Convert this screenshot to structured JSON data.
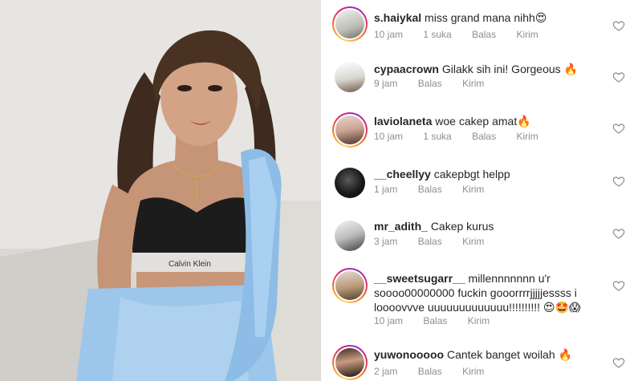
{
  "comments": [
    {
      "username": "s.haiykal",
      "text": "miss grand mana nihh😍",
      "time": "10 jam",
      "likes": "1 suka",
      "reply": "Balas",
      "send": "Kirim",
      "story_ring": true
    },
    {
      "username": "cypaacrown",
      "text": "Gilakk sih ini! Gorgeous 🔥",
      "time": "9 jam",
      "reply": "Balas",
      "send": "Kirim",
      "story_ring": false
    },
    {
      "username": "laviolaneta",
      "text": "woe cakep amat🔥",
      "time": "10 jam",
      "likes": "1 suka",
      "reply": "Balas",
      "send": "Kirim",
      "story_ring": true
    },
    {
      "username": "__cheellyy",
      "text": "cakepbgt helpp",
      "time": "1 jam",
      "reply": "Balas",
      "send": "Kirim",
      "story_ring": false
    },
    {
      "username": "mr_adith_",
      "text": "Cakep kurus",
      "time": "3 jam",
      "reply": "Balas",
      "send": "Kirim",
      "story_ring": false
    },
    {
      "username": "__sweetsugarr__",
      "text": "millennnnnnn u'r soooo00000000 fuckin gooorrrrjjjjjessss i loooovvve uuuuuuuuuuuuu!!!!!!!!!! 😍🤩😱",
      "time": "10 jam",
      "reply": "Balas",
      "send": "Kirim",
      "story_ring": true
    },
    {
      "username": "yuwonooooo",
      "text": "Cantek banget woilah 🔥",
      "time": "2 jam",
      "reply": "Balas",
      "send": "Kirim",
      "story_ring": true
    }
  ],
  "icons": {
    "like": "heart-outline-icon"
  },
  "colors": {
    "username": "#262626",
    "meta": "#8e8e8e",
    "outfit_blue": "#9cc6ea",
    "top_black": "#1c1c1c"
  }
}
